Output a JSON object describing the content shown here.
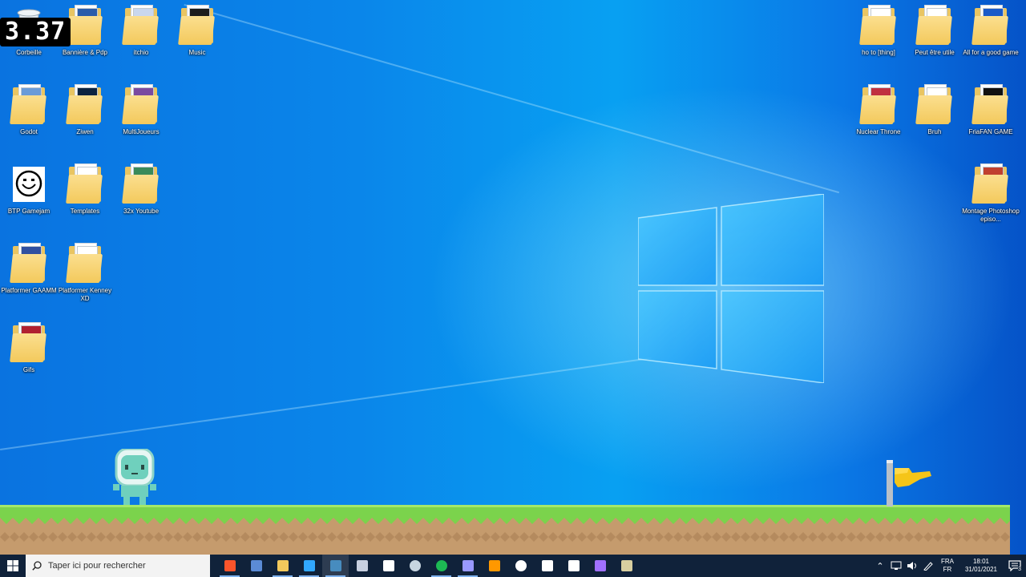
{
  "fps_counter": "3.37",
  "desktop_icons_left": [
    {
      "label": "Corbeille",
      "kind": "recycle-bin"
    },
    {
      "label": "Bannière & Pdp",
      "kind": "folder"
    },
    {
      "label": "itchio",
      "kind": "folder"
    },
    {
      "label": "Music",
      "kind": "folder"
    },
    {
      "label": "Godot",
      "kind": "folder"
    },
    {
      "label": "Ziwen",
      "kind": "folder"
    },
    {
      "label": "MultiJoueurs",
      "kind": "folder"
    },
    {
      "label": "BTP Gamejam",
      "kind": "shortcut"
    },
    {
      "label": "Templates",
      "kind": "folder"
    },
    {
      "label": "32x Youtube",
      "kind": "folder"
    },
    {
      "label": "Platformer GAAMM",
      "kind": "folder"
    },
    {
      "label": "Platformer Kenney XD",
      "kind": "folder"
    },
    {
      "label": "Gifs",
      "kind": "folder"
    }
  ],
  "desktop_icons_right": [
    {
      "label": "ho to [thing]",
      "kind": "folder"
    },
    {
      "label": "Peut être utile",
      "kind": "folder"
    },
    {
      "label": "All for a good game",
      "kind": "folder"
    },
    {
      "label": "Nuclear Throne",
      "kind": "folder"
    },
    {
      "label": "Bruh",
      "kind": "folder"
    },
    {
      "label": "FriaFAN GAME",
      "kind": "folder"
    },
    {
      "label": "Montage Photoshop episo...",
      "kind": "folder"
    }
  ],
  "taskbar": {
    "search_placeholder": "Taper ici pour rechercher",
    "apps": [
      {
        "icon": "brave-icon",
        "color": "#fb542b"
      },
      {
        "icon": "mail-icon",
        "color": "#5b8bd6"
      },
      {
        "icon": "file-explorer-icon",
        "color": "#f3c95c"
      },
      {
        "icon": "photoshop-icon",
        "color": "#31a8ff"
      },
      {
        "icon": "godot-icon",
        "color": "#478cbf"
      },
      {
        "icon": "aseprite-icon",
        "color": "#c8d0e0"
      },
      {
        "icon": "twitch-icon",
        "color": "#ffffff"
      },
      {
        "icon": "steam-icon",
        "color": "#c7d5e0"
      },
      {
        "icon": "spotify-icon",
        "color": "#1db954"
      },
      {
        "icon": "premiere-icon",
        "color": "#9999ff"
      },
      {
        "icon": "sublime-icon",
        "color": "#ff9800"
      },
      {
        "icon": "obs-icon",
        "color": "#ffffff"
      },
      {
        "icon": "monitor-icon",
        "color": "#ffffff"
      },
      {
        "icon": "epic-games-icon",
        "color": "#ffffff"
      },
      {
        "icon": "tetris-icon",
        "color": "#a070ff"
      },
      {
        "icon": "notes-icon",
        "color": "#d8cfa0"
      }
    ],
    "tray": {
      "language_line1": "FRA",
      "language_line2": "FR",
      "time": "18:01",
      "date": "31/01/2021",
      "notification_count": "3"
    }
  }
}
